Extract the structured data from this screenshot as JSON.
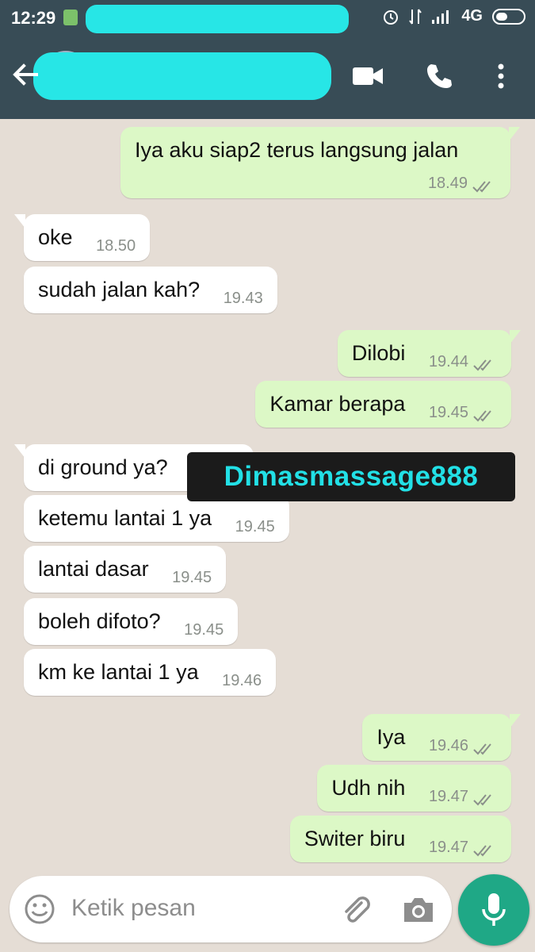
{
  "status_bar": {
    "time": "12:29",
    "network": "4G"
  },
  "header": {
    "icons": [
      "back-arrow-icon",
      "video-call-icon",
      "phone-icon",
      "more-vert-icon"
    ]
  },
  "messages": [
    {
      "dir": "out",
      "text": "Iya aku siap2 terus langsung jalan",
      "time": "18.49"
    },
    {
      "dir": "in",
      "text": "oke",
      "time": "18.50"
    },
    {
      "dir": "in",
      "text": "sudah jalan kah?",
      "time": "19.43"
    },
    {
      "dir": "out",
      "text": "Dilobi",
      "time": "19.44"
    },
    {
      "dir": "out",
      "text": "Kamar berapa",
      "time": "19.45"
    },
    {
      "dir": "in",
      "text": "di ground ya?",
      "time": ""
    },
    {
      "dir": "in",
      "text": "ketemu lantai 1 ya",
      "time": "19.45"
    },
    {
      "dir": "in",
      "text": "lantai dasar",
      "time": "19.45"
    },
    {
      "dir": "in",
      "text": "boleh difoto?",
      "time": "19.45"
    },
    {
      "dir": "in",
      "text": "km ke lantai 1 ya",
      "time": "19.46"
    },
    {
      "dir": "out",
      "text": "Iya",
      "time": "19.46"
    },
    {
      "dir": "out",
      "text": "Udh nih",
      "time": "19.47"
    },
    {
      "dir": "out",
      "text": "Switer biru",
      "time": "19.47"
    }
  ],
  "watermark": "Dimasmassage888",
  "composer": {
    "placeholder": "Ketik pesan",
    "icons": [
      "emoji-icon",
      "attach-icon",
      "camera-icon",
      "mic-icon"
    ]
  },
  "colors": {
    "header": "#384c56",
    "outgoing_bubble": "#dcf8c6",
    "incoming_bubble": "#ffffff",
    "chat_background": "#e5ddd5",
    "watermark_text": "#22e0e6",
    "mic_button": "#1fa886"
  }
}
